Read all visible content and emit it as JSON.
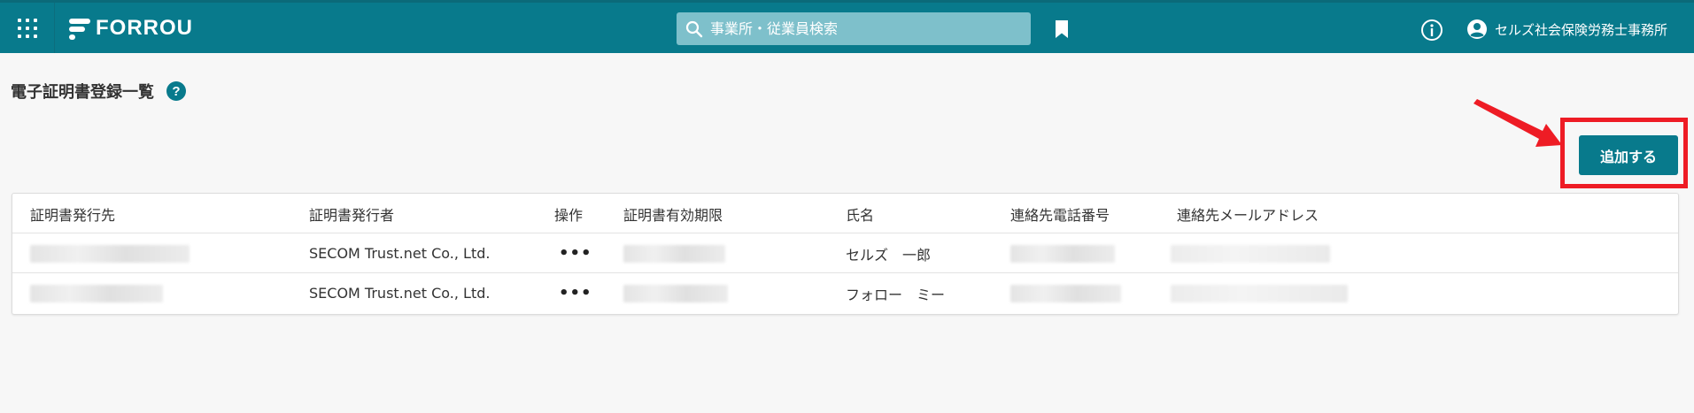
{
  "header": {
    "logo_text": "FORROU",
    "search_placeholder": "事業所・従業員検索",
    "user_name": "セルズ社会保険労務士事務所",
    "colors": {
      "bar": "#087a8c",
      "search_bg": "#7ec0cb"
    }
  },
  "page": {
    "title": "電子証明書登録一覧",
    "help_glyph": "?",
    "add_button_label": "追加する"
  },
  "table": {
    "columns": [
      "証明書発行先",
      "証明書発行者",
      "操作",
      "証明書有効期限",
      "氏名",
      "連絡先電話番号",
      "連絡先メールアドレス"
    ],
    "rows": [
      {
        "issuer": "SECOM Trust.net Co., Ltd.",
        "actions": "•••",
        "name": "セルズ　一郎"
      },
      {
        "issuer": "SECOM Trust.net Co., Ltd.",
        "actions": "•••",
        "name": "フォロー　ミー"
      }
    ]
  },
  "icons": [
    "app-grid-icon",
    "forrou-logo-icon",
    "search-icon",
    "bookmark-icon",
    "info-icon",
    "user-account-icon",
    "help-icon"
  ],
  "annotation_color": "#ee1c25"
}
